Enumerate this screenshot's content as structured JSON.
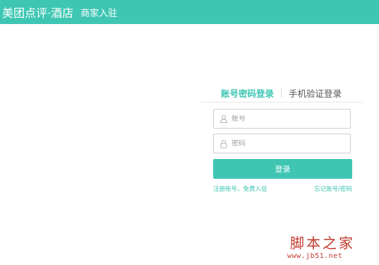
{
  "header": {
    "brand": "美团点评·酒店",
    "subtitle": "商家入驻"
  },
  "login": {
    "tabs": [
      {
        "label": "账号密码登录",
        "active": true
      },
      {
        "label": "手机验证登录",
        "active": false
      }
    ],
    "username": {
      "placeholder": "账号",
      "icon": "user-icon"
    },
    "password": {
      "placeholder": "密码",
      "icon": "lock-icon"
    },
    "submit_label": "登录",
    "register_link": "注册账号，免费入驻",
    "forgot_link": "忘记账号/密码"
  },
  "watermark": {
    "text": "脚本之家",
    "url": "www.jb51.net"
  },
  "colors": {
    "accent": "#3ec6b3",
    "watermark": "#c0392b"
  }
}
